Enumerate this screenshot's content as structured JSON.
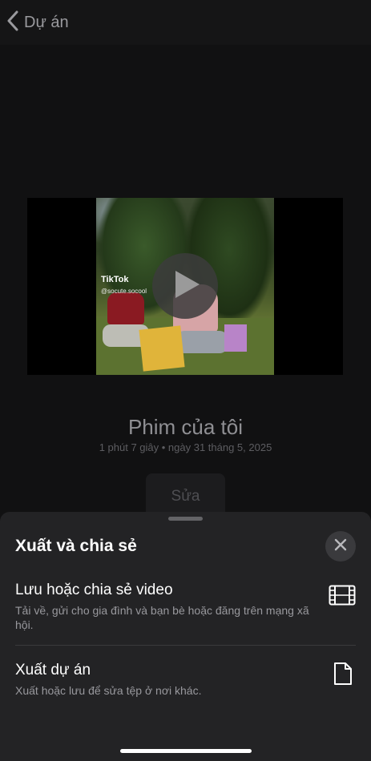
{
  "nav": {
    "back_label": "Dự án"
  },
  "project": {
    "title": "Phim của tôi",
    "meta": "1 phút 7 giây • ngày 31 tháng 5, 2025",
    "edit_label": "Sửa"
  },
  "video": {
    "watermark": "TikTok",
    "watermark_user": "@socute.socool"
  },
  "sheet": {
    "title": "Xuất và chia sẻ",
    "options": [
      {
        "title": "Lưu hoặc chia sẻ video",
        "description": "Tải về, gửi cho gia đình và bạn bè hoặc đăng trên mạng xã hội.",
        "icon": "film-icon"
      },
      {
        "title": "Xuất dự án",
        "description": "Xuất hoặc lưu để sửa tệp ở nơi khác.",
        "icon": "document-icon"
      }
    ]
  },
  "colors": {
    "background": "#0d0d0e",
    "sheet": "#232325",
    "close_button": "#3a3a3d"
  }
}
